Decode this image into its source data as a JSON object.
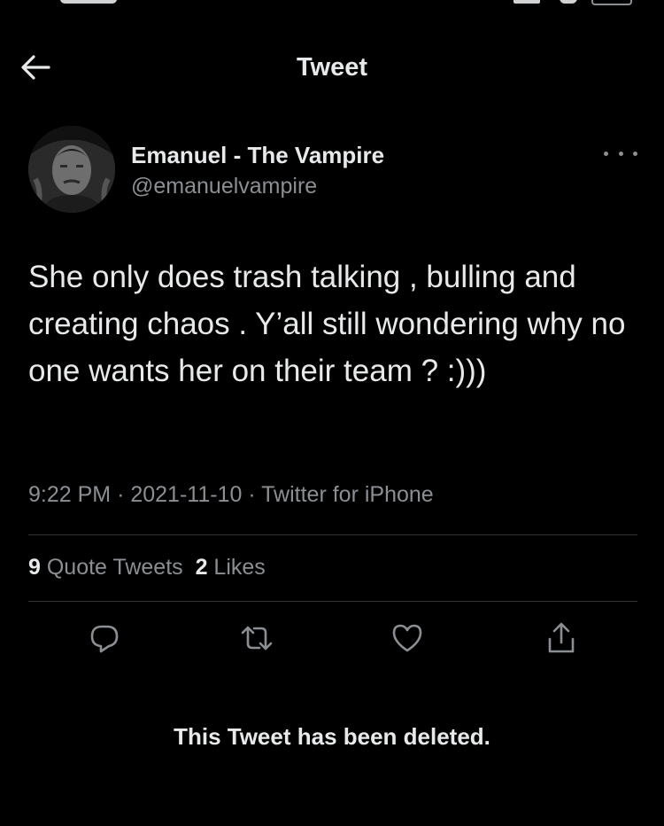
{
  "header": {
    "title": "Tweet",
    "back_icon": "arrow-left-icon"
  },
  "tweet": {
    "display_name": "Emanuel - The Vampire",
    "handle": "@emanuelvampire",
    "text": "She only does trash talking , bulling and creating chaos . Y’all still wondering why no one wants her on their team ? :)))",
    "time": "9:22 PM",
    "date": "2021-11-10",
    "separator": "·",
    "source": "Twitter for iPhone",
    "quote_tweets_count": "9",
    "quote_tweets_label": "Quote Tweets",
    "likes_count": "2",
    "likes_label": "Likes"
  },
  "actions": {
    "reply_icon": "reply-icon",
    "retweet_icon": "retweet-icon",
    "like_icon": "heart-icon",
    "share_icon": "share-icon"
  },
  "notice": "This Tweet has been deleted.",
  "colors": {
    "background": "#000000",
    "text_primary": "#e7e9ea",
    "text_secondary": "#8b8f93",
    "divider": "#2f3336"
  }
}
